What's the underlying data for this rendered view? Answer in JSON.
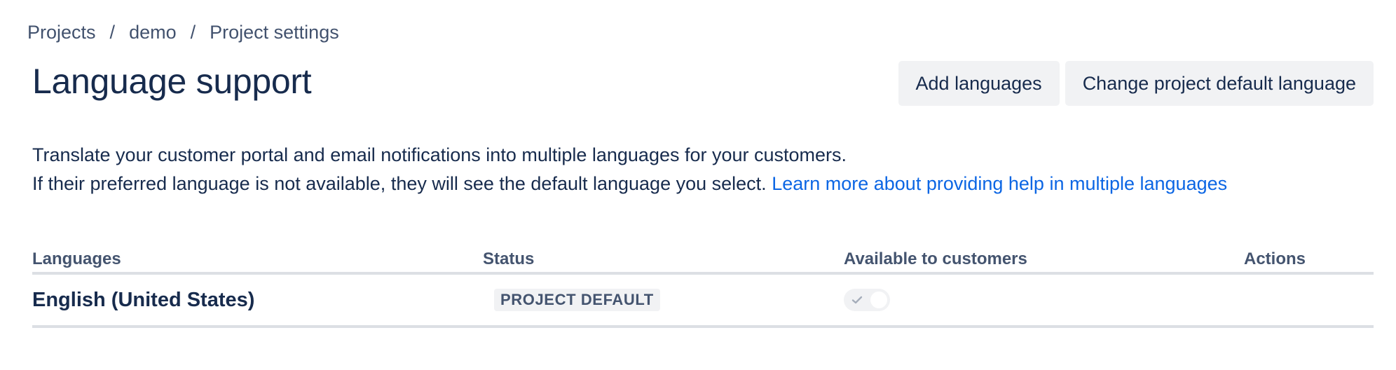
{
  "breadcrumb": {
    "items": [
      "Projects",
      "demo",
      "Project settings"
    ],
    "separator": "/"
  },
  "header": {
    "title": "Language support",
    "add_languages_label": "Add languages",
    "change_default_label": "Change project default language"
  },
  "description": {
    "line1": "Translate your customer portal and email notifications into multiple languages for your customers.",
    "line2": "If their preferred language is not available, they will see the default language you select.",
    "link_text": "Learn more about providing help in multiple languages"
  },
  "table": {
    "headers": {
      "languages": "Languages",
      "status": "Status",
      "available": "Available to customers",
      "actions": "Actions"
    },
    "rows": [
      {
        "language": "English (United States)",
        "status": "PROJECT DEFAULT",
        "available": true
      }
    ]
  },
  "colors": {
    "text_primary": "#172b4d",
    "text_subtle": "#44546f",
    "link": "#0c66e4",
    "button_bg": "#f1f2f4",
    "divider": "#dcdfe4"
  },
  "icons": {
    "toggle_check": "check-icon"
  }
}
